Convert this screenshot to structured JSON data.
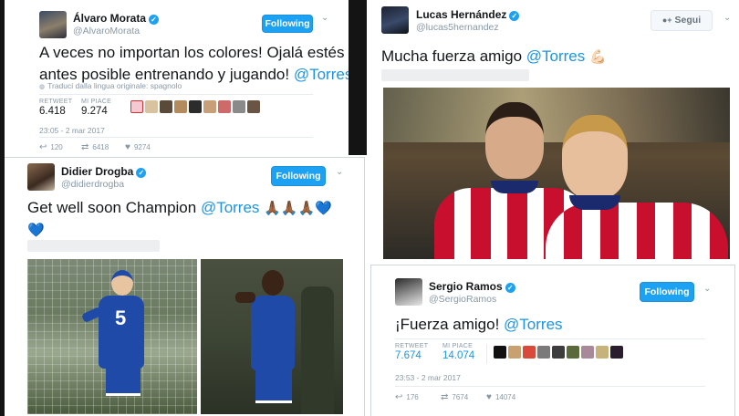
{
  "morata": {
    "name": "Álvaro Morata",
    "handle": "@AlvaroMorata",
    "follow_label": "Following",
    "text_line1": "A veces no importan los colores! Ojalá estés lo",
    "text_line2_pre": "antes posible entrenando y jugando! ",
    "mention": "@Torres",
    "translate": "Traduci dalla lingua originale: spagnolo",
    "retweet_label": "RETWEET",
    "retweet_value": "6.418",
    "like_label": "MI PIACE",
    "like_value": "9.274",
    "time": "23:05 - 2 mar 2017",
    "reply_count": "120",
    "rt_count": "6418",
    "like_count": "9274"
  },
  "drogba": {
    "name": "Didier Drogba",
    "handle": "@didierdrogba",
    "follow_label": "Following",
    "text_pre": "Get well soon Champion ",
    "mention": "@Torres",
    "emoji": "🙏🏾🙏🏾🙏🏾💙",
    "emoji_line2": "💙",
    "jersey_number": "5"
  },
  "hernandez": {
    "name": "Lucas Hernández",
    "handle": "@lucas5hernandez",
    "follow_label": "Segui",
    "text_pre": "Mucha fuerza amigo ",
    "mention": "@Torres",
    "emoji": "💪🏻"
  },
  "ramos": {
    "name": "Sergio Ramos",
    "handle": "@SergioRamos",
    "follow_label": "Following",
    "text_pre": "¡Fuerza amigo! ",
    "mention": "@Torres",
    "retweet_label": "RETWEET",
    "retweet_value": "7.674",
    "like_label": "MI PIACE",
    "like_value": "14.074",
    "time": "23:53 - 2 mar 2017",
    "reply_count": "176",
    "rt_count": "7674",
    "like_count": "14074"
  },
  "icons": {
    "verified": "✓",
    "chevron": "⌄",
    "reply": "↩",
    "retweet": "⇄",
    "heart": "♥",
    "globe": "🌐",
    "add_user": "👤+"
  },
  "colors": {
    "twitter_blue": "#1da1f2",
    "mention_blue": "#1b95e0",
    "chelsea_blue": "#1f4aa8",
    "atletico_red": "#c8102e"
  }
}
